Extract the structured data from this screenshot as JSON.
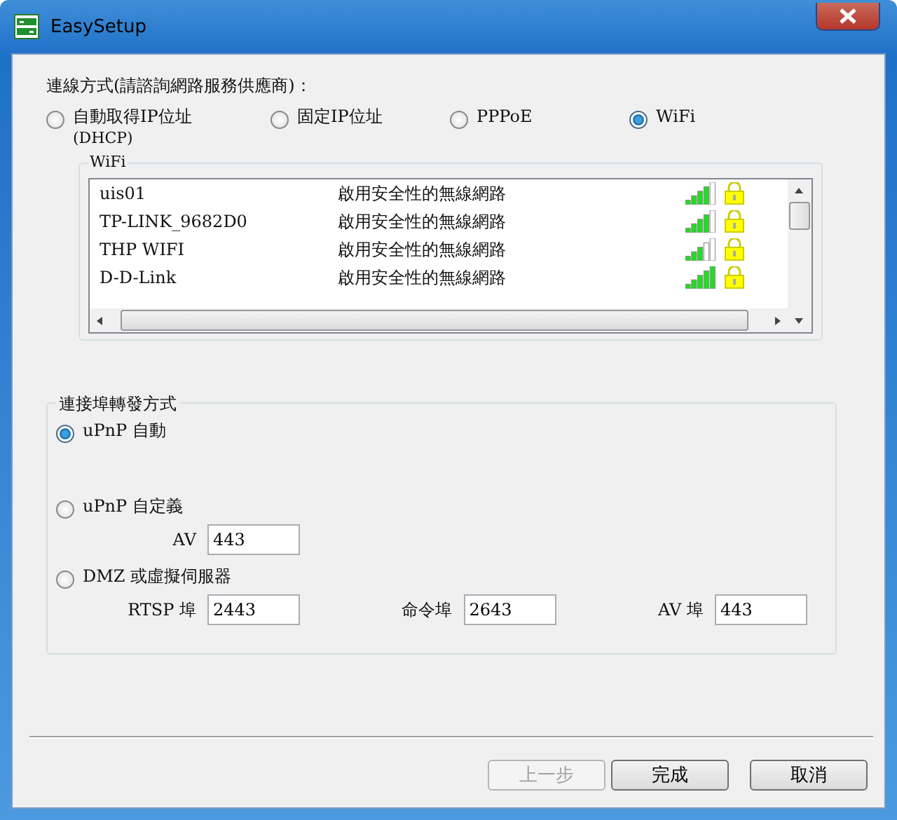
{
  "window": {
    "title": "EasySetup"
  },
  "connection": {
    "label": "連線方式(請諮詢網路服務供應商)：",
    "options": [
      {
        "label": "自動取得IP位址",
        "sublabel": "(DHCP)",
        "selected": false
      },
      {
        "label": "固定IP位址",
        "selected": false
      },
      {
        "label": "PPPoE",
        "selected": false
      },
      {
        "label": "WiFi",
        "selected": true
      }
    ]
  },
  "wifi": {
    "label": "WiFi",
    "networks": [
      {
        "ssid": "uis01",
        "security": "啟用安全性的無線網路",
        "kind": "good",
        "locked": true
      },
      {
        "ssid": "TP-LINK_9682D0",
        "security": "啟用安全性的無線網路",
        "kind": "good",
        "locked": true
      },
      {
        "ssid": "THP WIFI",
        "security": "啟用安全性的無線網路",
        "kind": "fair",
        "locked": true
      },
      {
        "ssid": "D-D-Link",
        "security": "啟用安全性的無線網路",
        "kind": "excellent",
        "locked": true
      }
    ]
  },
  "port_forwarding": {
    "label": "連接埠轉發方式",
    "options": [
      {
        "label": "uPnP 自動",
        "selected": true
      },
      {
        "label": "uPnP 自定義",
        "selected": false,
        "fields": [
          {
            "label": "AV",
            "value": "443"
          }
        ]
      },
      {
        "label": "DMZ 或虛擬伺服器",
        "selected": false,
        "fields": [
          {
            "label": "RTSP 埠",
            "value": "2443"
          },
          {
            "label": "命令埠",
            "value": "2643"
          },
          {
            "label": "AV 埠",
            "value": "443"
          }
        ]
      }
    ]
  },
  "buttons": [
    {
      "label": "上一步",
      "disabled": true
    },
    {
      "label": "完成",
      "disabled": false
    },
    {
      "label": "取消",
      "disabled": false
    }
  ]
}
